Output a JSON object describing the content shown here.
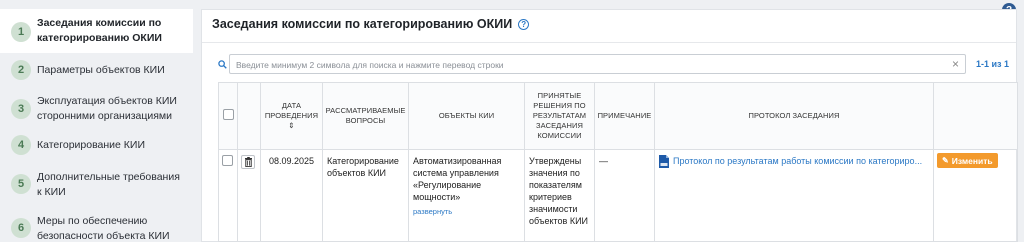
{
  "sidebar": {
    "items": [
      {
        "num": "1",
        "label": "Заседания комиссии по категорированию ОКИИ",
        "active": true
      },
      {
        "num": "2",
        "label": "Параметры объектов КИИ"
      },
      {
        "num": "3",
        "label": "Эксплуатация объектов КИИ сторонними организациями"
      },
      {
        "num": "4",
        "label": "Категорирование КИИ"
      },
      {
        "num": "5",
        "label": "Дополнительные требования к КИИ"
      },
      {
        "num": "6",
        "label": "Меры по обеспечению безопасности объекта КИИ"
      }
    ]
  },
  "help": {
    "glyph": "?"
  },
  "main": {
    "title": "Заседания комиссии по категорированию ОКИИ",
    "title_help_glyph": "?"
  },
  "search": {
    "placeholder": "Введите минимум 2 символа для поиска и нажмите перевод строки",
    "value": "",
    "clear_glyph": "×"
  },
  "pager": {
    "text": "1-1 из 1"
  },
  "table": {
    "headers": {
      "date": "ДАТА ПРОВЕДЕНИЯ ⇕",
      "questions": "РАССМАТРИВАЕМЫЕ ВОПРОСЫ",
      "objects": "ОБЪЕКТЫ КИИ",
      "decisions": "ПРИНЯТЫЕ РЕШЕНИЯ ПО РЕЗУЛЬТАТАМ ЗАСЕДАНИЯ КОМИССИИ",
      "note": "ПРИМЕЧАНИЕ",
      "protocol": "ПРОТОКОЛ ЗАСЕДАНИЯ"
    },
    "rows": [
      {
        "date": "08.09.2025",
        "questions": "Категорирование объектов КИИ",
        "objects": "Автоматизированная система управления «Регулирование мощности»",
        "expand": "развернуть",
        "decisions": "Утверждены значения по показателям критериев значимости объектов КИИ",
        "note": "—",
        "protocol": "Протокол по результатам работы комиссии по категориро...",
        "edit": "Изменить"
      }
    ]
  },
  "colors": {
    "accent": "#2b78c5",
    "edit": "#f39a2c",
    "step_badge": "#cfe0d2"
  }
}
